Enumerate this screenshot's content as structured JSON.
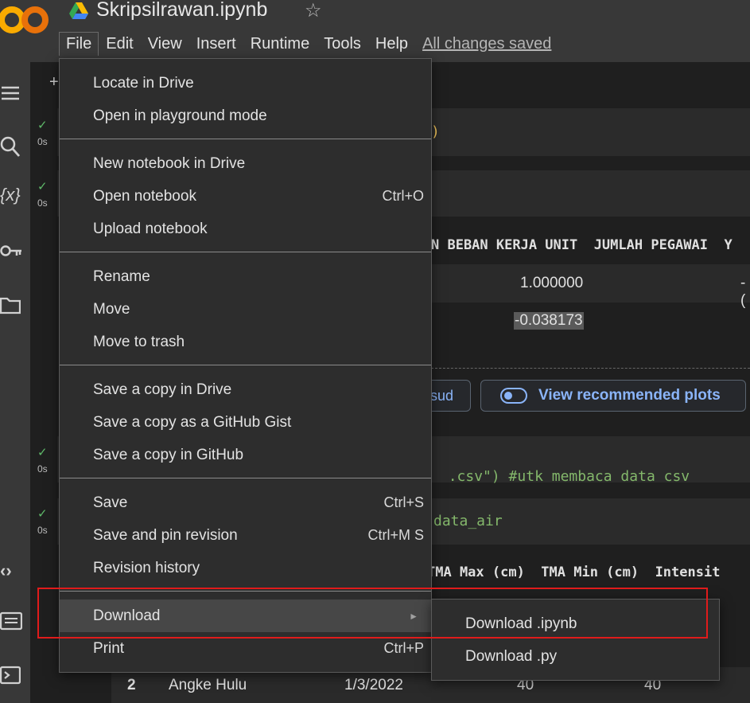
{
  "header": {
    "title": "Skripsilrawan.ipynb",
    "logo_text": "CO",
    "star_icon": "star-icon",
    "menus": [
      "File",
      "Edit",
      "View",
      "Insert",
      "Runtime",
      "Tools",
      "Help"
    ],
    "save_status": "All changes saved"
  },
  "gutter": [
    {
      "check": "✓",
      "time": "0s"
    },
    {
      "check": "✓",
      "time": "0s"
    },
    {
      "check": "✓",
      "time": "0s"
    },
    {
      "check": "✓",
      "time": "0s"
    }
  ],
  "notebook": {
    "toolbar_plus": "+",
    "cell1_code_tail": ")",
    "corr_headers": "N BEBAN KERJA UNIT  JUMLAH PEGAWAI  Y",
    "corr_row1_val": "1.000000",
    "corr_row1_val2": "-(",
    "corr_row2_val": "-0.038173",
    "chip_left_text": "sud",
    "chip_right_text": "View recommended plots",
    "cell3_code_part1": ".csv\")",
    "cell3_code_comment": " #utk membaca data csv",
    "cell4_code": "data_air",
    "data_headers": "TMA Max (cm)  TMA Min (cm)  Intensit",
    "data_row": {
      "index": "2",
      "name": "Angke Hulu",
      "date": "1/3/2022",
      "max": "40",
      "min": "40"
    }
  },
  "file_menu": {
    "items": [
      {
        "label": "Locate in Drive",
        "shortcut": ""
      },
      {
        "label": "Open in playground mode",
        "shortcut": ""
      },
      {
        "label": "New notebook in Drive",
        "shortcut": ""
      },
      {
        "label": "Open notebook",
        "shortcut": "Ctrl+O"
      },
      {
        "label": "Upload notebook",
        "shortcut": ""
      },
      {
        "label": "Rename",
        "shortcut": ""
      },
      {
        "label": "Move",
        "shortcut": ""
      },
      {
        "label": "Move to trash",
        "shortcut": ""
      },
      {
        "label": "Save a copy in Drive",
        "shortcut": ""
      },
      {
        "label": "Save a copy as a GitHub Gist",
        "shortcut": ""
      },
      {
        "label": "Save a copy in GitHub",
        "shortcut": ""
      },
      {
        "label": "Save",
        "shortcut": "Ctrl+S"
      },
      {
        "label": "Save and pin revision",
        "shortcut": "Ctrl+M S"
      },
      {
        "label": "Revision history",
        "shortcut": ""
      },
      {
        "label": "Download",
        "shortcut": "►"
      },
      {
        "label": "Print",
        "shortcut": "Ctrl+P"
      }
    ]
  },
  "download_submenu": {
    "items": [
      "Download .ipynb",
      "Download .py"
    ]
  },
  "colors": {
    "highlight_box": "#e01b1b",
    "check": "#5fba6a",
    "chip_text": "#8ab4f8"
  }
}
